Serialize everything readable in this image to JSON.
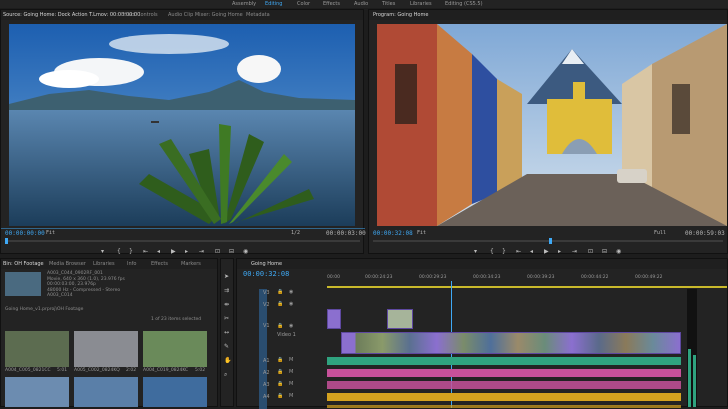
{
  "workspaces": [
    "Assembly",
    "Editing",
    "Color",
    "Effects",
    "Audio",
    "Titles",
    "Libraries",
    "Editing (CS5.5)"
  ],
  "active_workspace": "Editing",
  "source": {
    "tabs": [
      "Source: Going Home: Dock Action T.Lmov: 00:00:00:00",
      "Effect Controls",
      "Audio Clip Mixer: Going Home",
      "Metadata"
    ],
    "timecode_left": "00:00:00:00",
    "fit": "Fit",
    "ratio": "1/2",
    "timecode_right": "00:00:03:00"
  },
  "program": {
    "tab": "Program: Going Home",
    "timecode_left": "00:00:32:08",
    "fit": "Fit",
    "full": "Full",
    "timecode_right": "00:00:59:03"
  },
  "project": {
    "tabs": [
      "Bin: OH Footage",
      "Media Browser",
      "Libraries",
      "Info",
      "Effects",
      "Markers"
    ],
    "clip_info": [
      "A003_C044_0902RF_001",
      "Movie, 640 x 360 (1.0), 23.976 fps",
      "00:00:03:00, 23.976p",
      "48000 Hz - Compressed - Stereo",
      "A003_C014"
    ],
    "bin_path": "Going Home_v1.prproj\\OH Footage",
    "items_selected": "1 of 23 items selected",
    "thumbs": [
      {
        "name": "A004_C005_0821CC",
        "dur": "5:01"
      },
      {
        "name": "A005_C002_0824KQ",
        "dur": "2:02"
      },
      {
        "name": "A004_C019_0824KC",
        "dur": "5:02"
      },
      {
        "name": "",
        "dur": ""
      },
      {
        "name": "",
        "dur": ""
      },
      {
        "name": "",
        "dur": ""
      }
    ]
  },
  "timeline": {
    "tab": "Going Home",
    "timecode": "00:00:32:08",
    "ruler": [
      "00:00",
      "00:00:24:23",
      "00:00:29:23",
      "00:00:34:23",
      "00:00:39:23",
      "00:00:44:22",
      "00:00:49:22"
    ],
    "video_tracks": [
      "V3",
      "V2",
      "V1"
    ],
    "audio_tracks": [
      "A1",
      "A2",
      "A3",
      "A4"
    ],
    "v1_label": "Video 1"
  },
  "colors": {
    "accent": "#3fa9f5",
    "video_clip": "#8b6fcf",
    "audio_teal": "#2fa37f",
    "audio_pink": "#c7519a",
    "audio_gold": "#d4a21f"
  }
}
